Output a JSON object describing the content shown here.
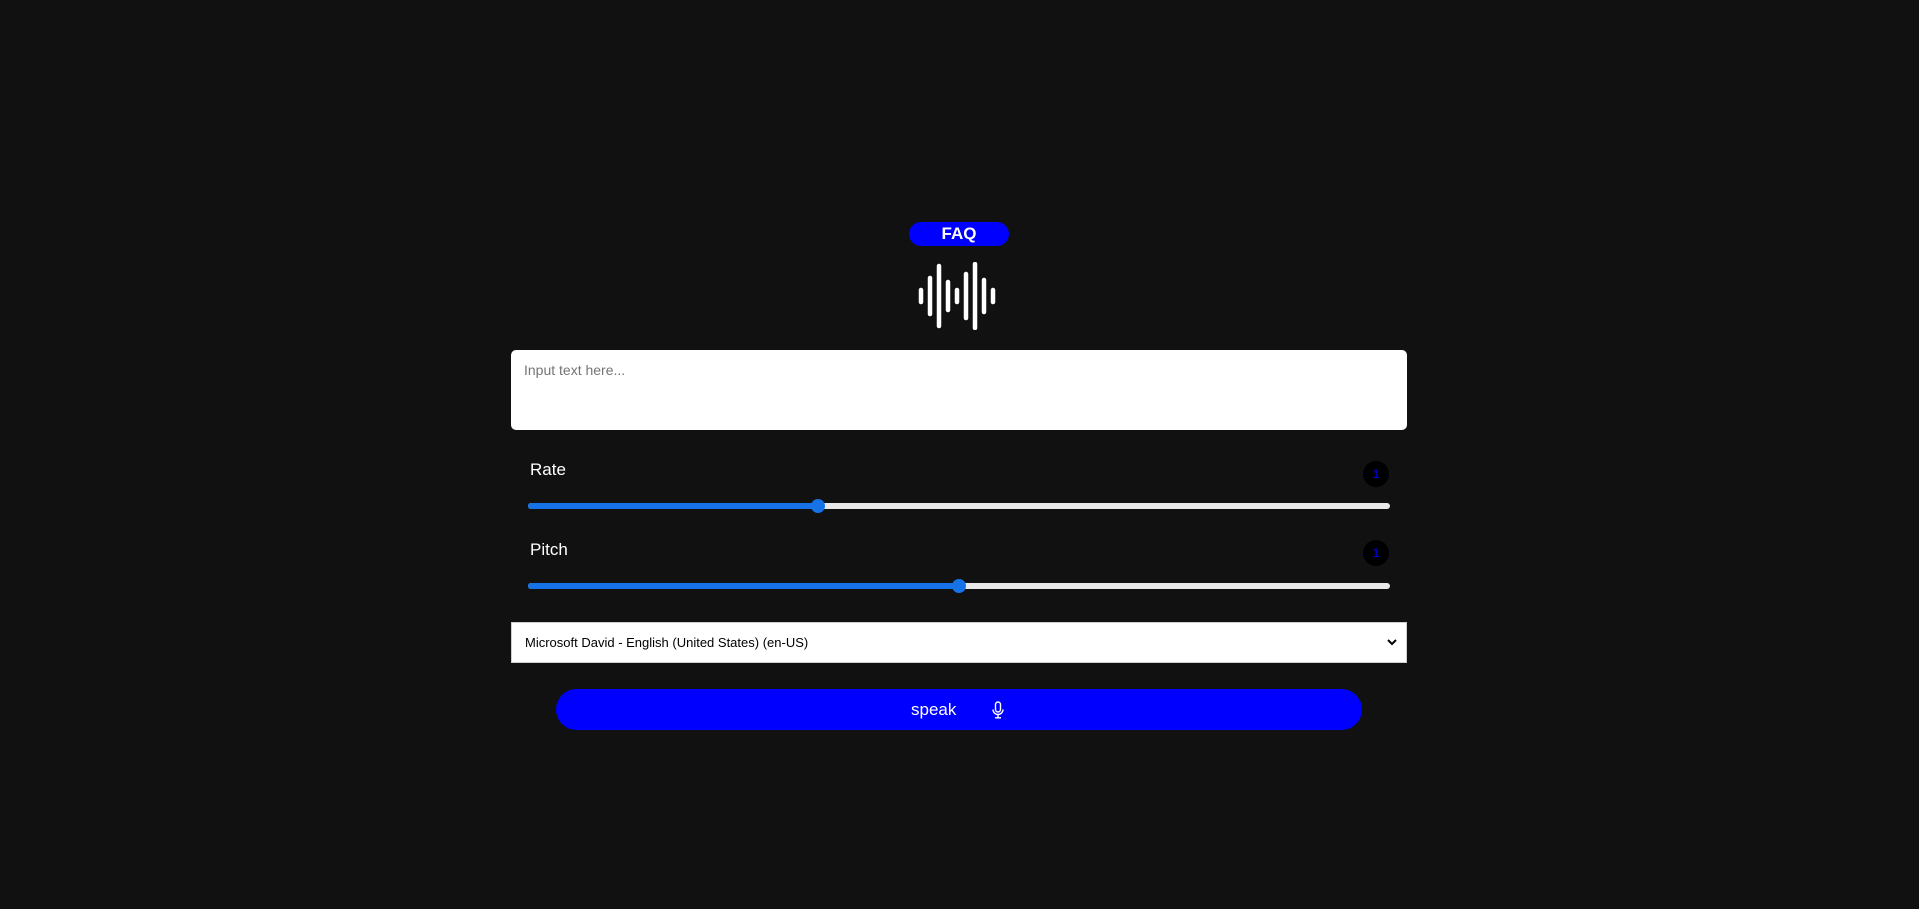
{
  "faq": {
    "label": "FAQ"
  },
  "logo": {
    "icon": "sound-wave-icon"
  },
  "text_input": {
    "placeholder": "Input text here...",
    "value": ""
  },
  "rate": {
    "label": "Rate",
    "value": "1",
    "fraction": 0.336
  },
  "pitch": {
    "label": "Pitch",
    "value": "1",
    "fraction": 0.5
  },
  "voice_select": {
    "selected": "Microsoft David - English (United States) (en-US)"
  },
  "speak_button": {
    "label": "speak",
    "icon": "microphone-icon"
  },
  "colors": {
    "background": "#111111",
    "accent": "#0000ff",
    "slider": "#1672e6",
    "slider_track": "#e9e9e9"
  }
}
